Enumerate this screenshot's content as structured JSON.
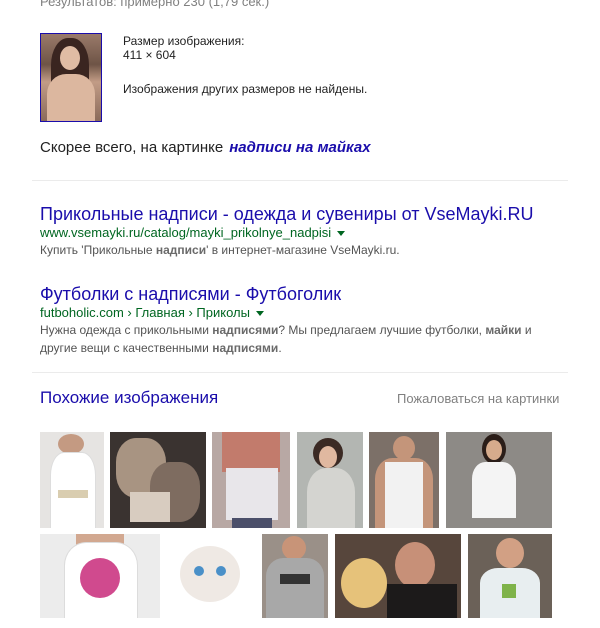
{
  "stats": "Результатов: примерно 230 (1,79 сек.)",
  "image_info": {
    "size_label": "Размер изображения:",
    "size_value": "411 × 604",
    "no_other_sizes": "Изображения других размеров не найдены."
  },
  "best_guess": {
    "prefix": "Скорее всего, на картинке",
    "link": "надписи на майках"
  },
  "results": [
    {
      "title": "Прикольные надписи - одежда и сувениры от VseMayki.RU",
      "url": "www.vsemayki.ru/catalog/mayki_prikolnye_nadpisi",
      "snippet_parts": [
        {
          "t": "Купить 'Прикольные ",
          "b": false
        },
        {
          "t": "надписи",
          "b": true
        },
        {
          "t": "' в интернет-магазине VseMayki.ru.",
          "b": false
        }
      ]
    },
    {
      "title": "Футболки с надписями - Футбоголик",
      "url": "futboholic.com › Главная › Приколы",
      "snippet_parts": [
        {
          "t": "Нужна одежда с прикольными ",
          "b": false
        },
        {
          "t": "надписями",
          "b": true
        },
        {
          "t": "? Мы предлагаем лучшие футболки, ",
          "b": false
        },
        {
          "t": "майки",
          "b": true
        },
        {
          "t": " и другие вещи с качественными ",
          "b": false
        },
        {
          "t": "надписями",
          "b": true
        },
        {
          "t": ".",
          "b": false
        }
      ]
    }
  ],
  "similar": {
    "title": "Похожие изображения",
    "report": "Пожаловаться на картинки"
  }
}
